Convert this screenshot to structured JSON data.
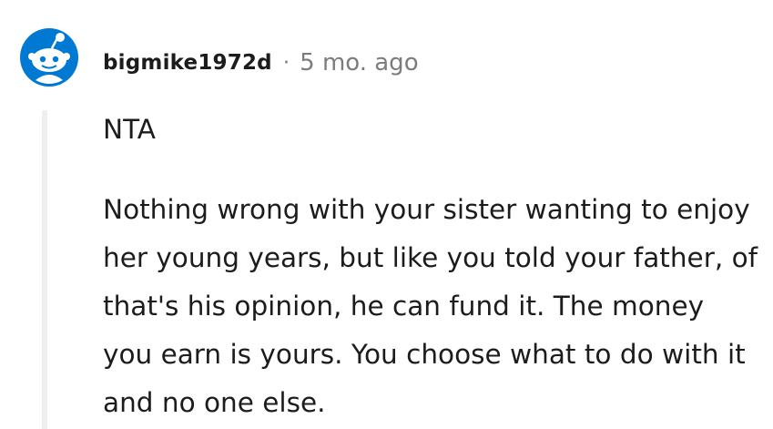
{
  "comment": {
    "username": "bigmike1972d",
    "separator": "·",
    "timestamp": "5 mo. ago",
    "avatar_icon": "snoo-avatar-icon",
    "paragraphs": [
      "NTA",
      "Nothing wrong with your sister wanting to enjoy her young years, but like you told your father, of that's his opinion, he can fund it. The money you earn is yours. You choose what to do with it and no one else."
    ]
  },
  "colors": {
    "avatar_background": "#0dd3bb",
    "text": "#1c1c1c",
    "muted": "#7c7c7c",
    "thread_line": "#edeff1"
  }
}
